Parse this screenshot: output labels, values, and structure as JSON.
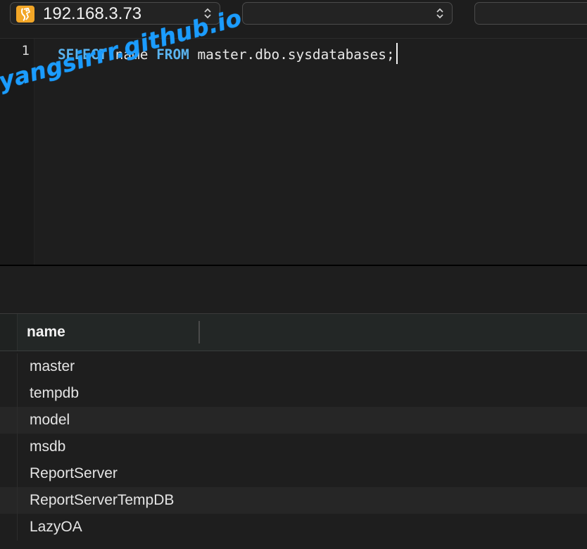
{
  "toolbar": {
    "connection": {
      "label": "192.168.3.73",
      "icon": "database-app-icon"
    },
    "database": {
      "label": ""
    },
    "third": {
      "label": ""
    }
  },
  "editor": {
    "line_numbers": [
      "1"
    ],
    "query": {
      "kw_select": "SELECT",
      "column": " name ",
      "kw_from": "FROM",
      "rest": " master.dbo.sysdatabases;"
    }
  },
  "watermark": "yangsirrr.github.io",
  "results": {
    "columns": [
      "name"
    ],
    "rows": [
      "master",
      "tempdb",
      "model",
      "msdb",
      "ReportServer",
      "ReportServerTempDB",
      "LazyOA"
    ]
  },
  "colors": {
    "keyword": "#5ab3ee",
    "watermark": "#1b9cff",
    "app_icon": "#f2a627"
  }
}
